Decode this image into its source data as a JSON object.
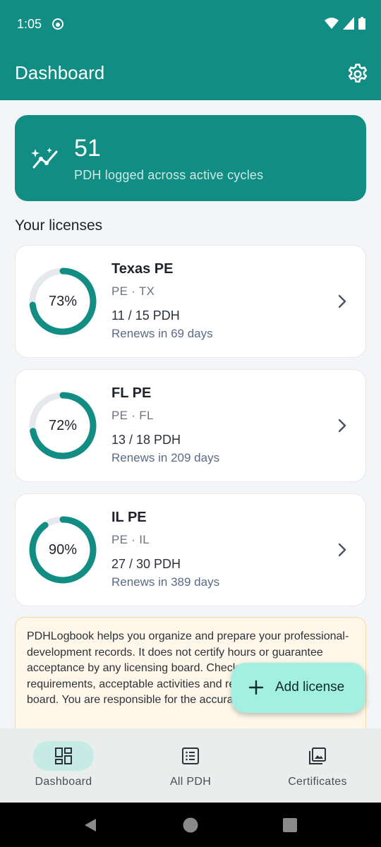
{
  "status_bar": {
    "time": "1:05",
    "app_icon": "smiley-icon",
    "icons": [
      "wifi-icon",
      "signal-icon",
      "battery-icon"
    ]
  },
  "app_bar": {
    "title": "Dashboard",
    "settings_icon": "gear-icon"
  },
  "summary": {
    "value": "51",
    "caption": "PDH logged across active cycles",
    "icon": "trending-sparkle-icon"
  },
  "section_heading": "Your licenses",
  "licenses": [
    {
      "name": "Texas PE",
      "meta": "PE · TX",
      "progress_text": "11 / 15 PDH",
      "renew_text": "Renews in 69 days",
      "percent_label": "73%",
      "percent": 0.73
    },
    {
      "name": "FL PE",
      "meta": "PE · FL",
      "progress_text": "13 / 18 PDH",
      "renew_text": "Renews in 209 days",
      "percent_label": "72%",
      "percent": 0.72
    },
    {
      "name": "IL PE",
      "meta": "PE · IL",
      "progress_text": "27 / 30 PDH",
      "renew_text": "Renews in 389 days",
      "percent_label": "90%",
      "percent": 0.9
    }
  ],
  "disclaimer": "PDHLogbook helps you organize and prepare your professional-development records. It does not certify hours or guarantee acceptance by any licensing board. Check your state's PDH requirements, acceptable activities and retention period with your board. You are responsible for the accuracy of your records.",
  "fab": {
    "label": "Add license",
    "icon": "plus-icon"
  },
  "bottom_nav": [
    {
      "label": "Dashboard",
      "icon": "dashboard-icon",
      "active": true
    },
    {
      "label": "All PDH",
      "icon": "list-icon",
      "active": false
    },
    {
      "label": "Certificates",
      "icon": "photo-library-icon",
      "active": false
    }
  ],
  "system_nav": {
    "icons": [
      "back-icon",
      "home-icon",
      "recents-icon"
    ]
  },
  "colors": {
    "primary": "#118d83",
    "ring_track": "#e5e8ec",
    "fab": "#a3efe2",
    "nav_active": "#c6ebe4",
    "disclaimer_bg": "#fff8ea"
  }
}
